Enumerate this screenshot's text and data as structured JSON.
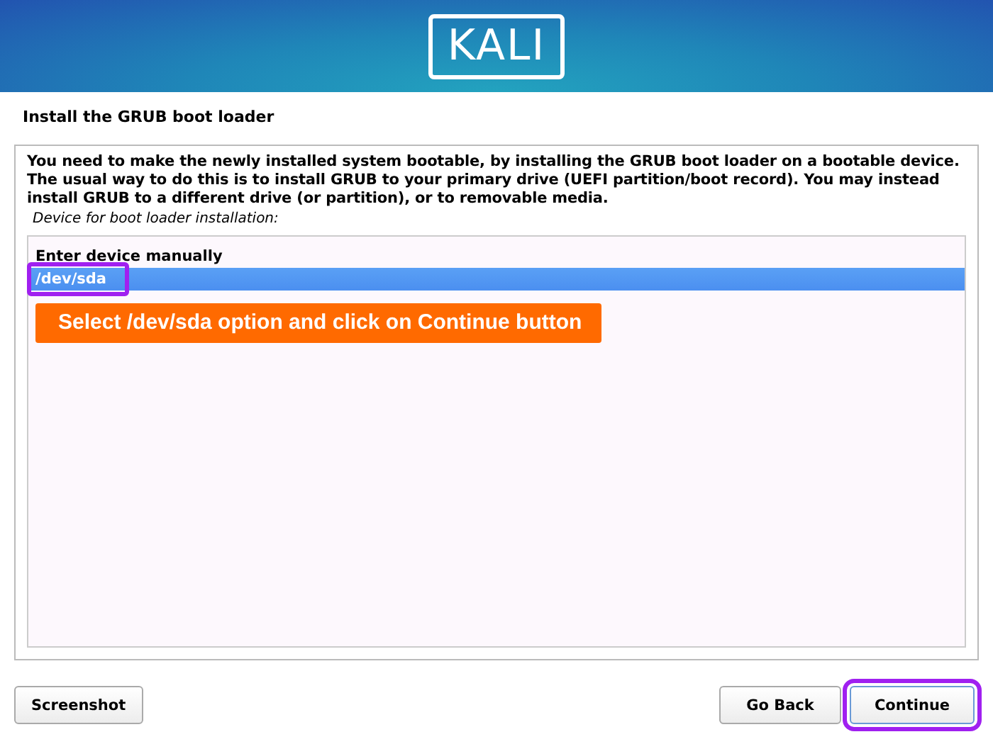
{
  "logo": {
    "text": "KALI"
  },
  "title": "Install the GRUB boot loader",
  "description": "You need to make the newly installed system bootable, by installing the GRUB boot loader on a bootable device. The usual way to do this is to install GRUB to your primary drive (UEFI partition/boot record). You may instead install GRUB to a different drive (or partition), or to removable media.",
  "field_label": "Device for boot loader installation:",
  "options": [
    {
      "label": "Enter device manually",
      "selected": false,
      "highlighted": false
    },
    {
      "label": "/dev/sda",
      "selected": true,
      "highlighted": true
    }
  ],
  "callout": "Select /dev/sda option and click on Continue button",
  "buttons": [
    {
      "label": "Screenshot",
      "highlighted": false
    },
    {
      "label": "Go Back",
      "highlighted": false
    },
    {
      "label": "Continue",
      "highlighted": true
    }
  ]
}
